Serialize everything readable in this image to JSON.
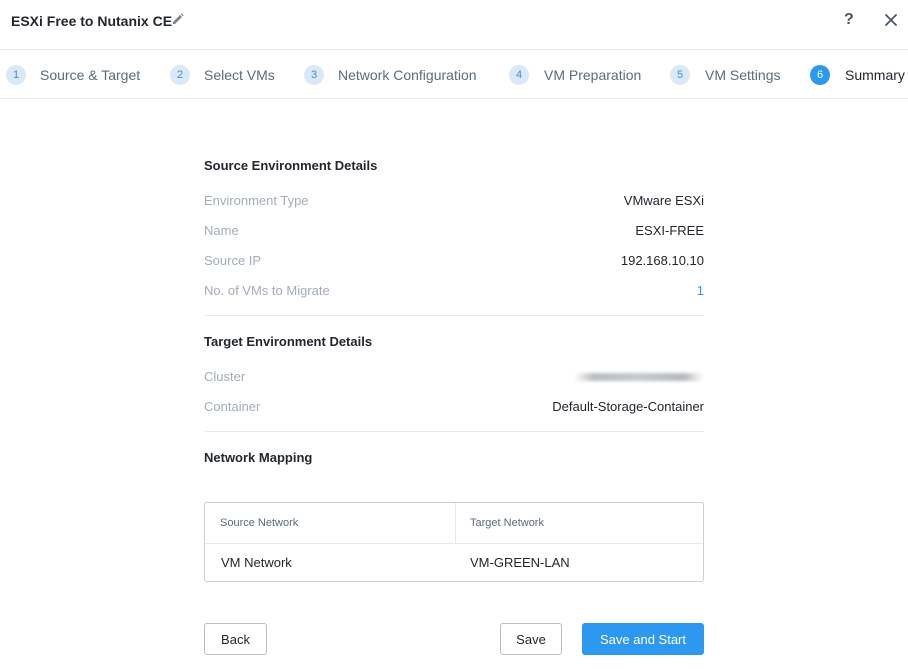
{
  "header": {
    "title": "ESXi Free to Nutanix CE",
    "help_label": "?"
  },
  "steps": [
    {
      "num": "1",
      "label": "Source & Target"
    },
    {
      "num": "2",
      "label": "Select VMs"
    },
    {
      "num": "3",
      "label": "Network Configuration"
    },
    {
      "num": "4",
      "label": "VM Preparation"
    },
    {
      "num": "5",
      "label": "VM Settings"
    },
    {
      "num": "6",
      "label": "Summary",
      "active": true
    }
  ],
  "source": {
    "title": "Source Environment Details",
    "rows": [
      {
        "key": "Environment Type",
        "value": "VMware ESXi"
      },
      {
        "key": "Name",
        "value": "ESXI-FREE"
      },
      {
        "key": "Source IP",
        "value": "192.168.10.10"
      },
      {
        "key": "No. of VMs to Migrate",
        "value": "1"
      }
    ]
  },
  "target": {
    "title": "Target Environment Details",
    "rows": [
      {
        "key": "Cluster",
        "value": ""
      },
      {
        "key": "Container",
        "value": "Default-Storage-Container"
      }
    ]
  },
  "network": {
    "title": "Network Mapping",
    "headers": [
      "Source Network",
      "Target Network"
    ],
    "rows": [
      [
        "VM Network",
        "VM-GREEN-LAN"
      ]
    ]
  },
  "buttons": {
    "back": "Back",
    "save": "Save",
    "save_start": "Save and Start"
  },
  "colors": {
    "accent": "#2c98f0",
    "muted_text": "#a3adb8",
    "step_bubble": "#dbe9f7"
  }
}
